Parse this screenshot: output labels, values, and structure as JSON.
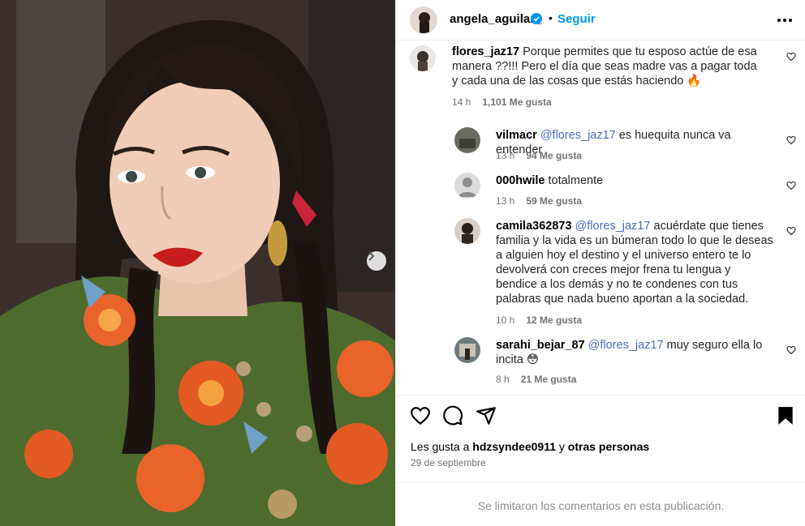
{
  "post": {
    "author": "angela_aguilar_",
    "follow_label": "Seguir",
    "dot": "•"
  },
  "comments": [
    {
      "user": "flores_jaz17",
      "text": "Porque permites que tu esposo actúe de esa manera ??!!! Pero el día que seas madre vas a pagar toda y cada una de las cosas que estás haciendo",
      "emoji": "🔥",
      "time": "14 h",
      "likes": "1,101 Me gusta"
    },
    {
      "user": "vilmacr",
      "mention": "@flores_jaz17",
      "text": "es huequita nunca va entender",
      "time": "13 h",
      "likes": "94 Me gusta"
    },
    {
      "user": "000hwile",
      "text": "totalmente",
      "time": "13 h",
      "likes": "59 Me gusta"
    },
    {
      "user": "camila362873",
      "mention": "@flores_jaz17",
      "text": "acuérdate que tienes familia y la vida es un búmeran todo lo que le deseas a alguien hoy el destino y el universo entero te lo devolverá con creces mejor frena tu lengua y bendice a los demás y no te condenes con tus palabras que nada bueno aportan a la sociedad.",
      "time": "10 h",
      "likes": "12 Me gusta"
    },
    {
      "user": "sarahi_bejar_87",
      "mention": "@flores_jaz17",
      "text": "muy seguro ella lo incita",
      "emoji": "😳",
      "time": "8 h",
      "likes": "21 Me gusta"
    }
  ],
  "likes_line": {
    "prefix": "Les gusta a",
    "user": "hdzsyndee0911",
    "connector": "y",
    "others": "otras personas"
  },
  "date": "29 de septiembre",
  "footer_text": "Se limitaron los comentarios en esta publicación.",
  "colors": {
    "accent": "#0095f6",
    "mention": "#4a6cbf",
    "muted": "#737373"
  },
  "icons": [
    "heart-icon",
    "comment-icon",
    "share-icon",
    "bookmark-icon",
    "more-icon",
    "verified-icon",
    "chevron-right-icon"
  ]
}
